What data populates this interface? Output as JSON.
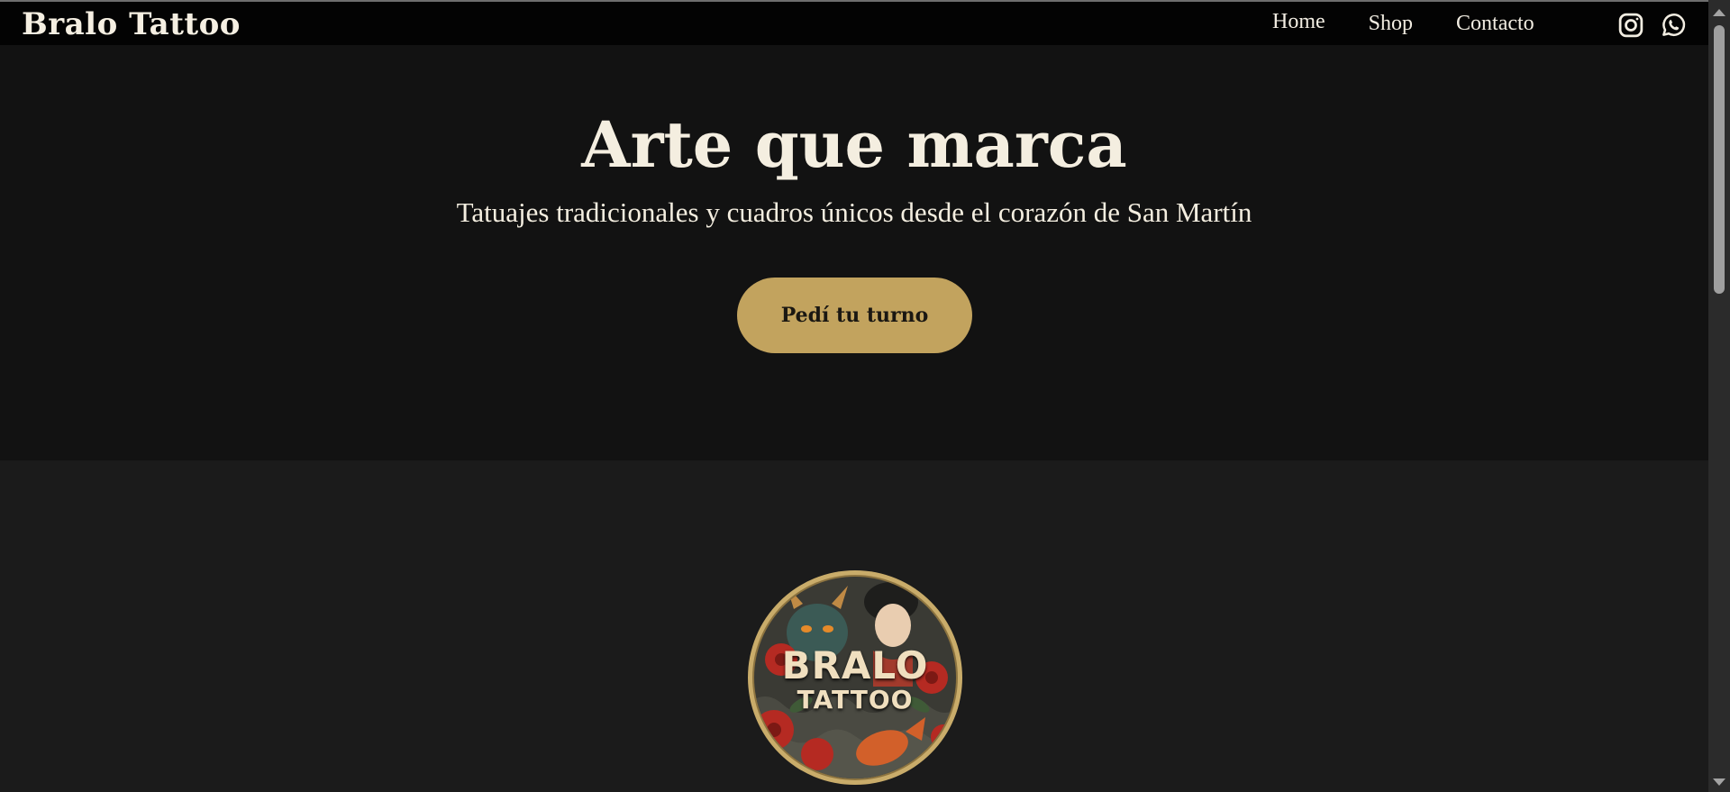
{
  "nav": {
    "brand": "Bralo Tattoo",
    "links": [
      {
        "label": "Home"
      },
      {
        "label": "Shop"
      },
      {
        "label": "Contacto"
      }
    ],
    "social": [
      {
        "icon": "instagram-icon"
      },
      {
        "icon": "whatsapp-icon"
      }
    ]
  },
  "hero": {
    "title": "Arte que marca",
    "subtitle": "Tatuajes tradicionales y cuadros únicos desde el corazón de San Martín",
    "cta_label": "Pedí tu turno"
  },
  "logo": {
    "line1": "BRALO",
    "line2": "TATTOO"
  },
  "colors": {
    "nav_bg": "#030303",
    "hero_bg": "#121212",
    "section_bg": "#1b1b1b",
    "accent": "#c2a35e",
    "text": "#f4eee0"
  }
}
